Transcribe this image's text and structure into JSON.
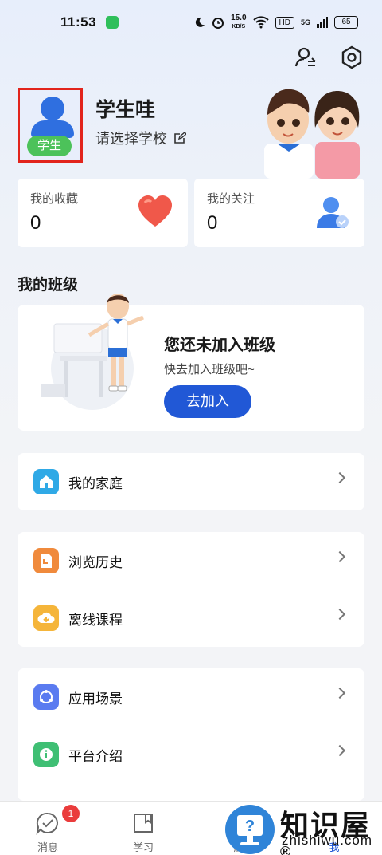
{
  "status_bar": {
    "time": "11:53",
    "speed": "15.0",
    "speed_unit": "KB/S",
    "hd": "HD",
    "net": "5G",
    "battery": "65"
  },
  "profile": {
    "name": "学生哇",
    "school_prompt": "请选择学校",
    "role_badge": "学生"
  },
  "stats": {
    "favorites_label": "我的收藏",
    "favorites_value": "0",
    "following_label": "我的关注",
    "following_value": "0"
  },
  "my_class": {
    "section_title": "我的班级",
    "empty_title": "您还未加入班级",
    "empty_subtitle": "快去加入班级吧~",
    "join_button": "去加入"
  },
  "menu": {
    "family": "我的家庭",
    "history": "浏览历史",
    "offline": "离线课程",
    "scenarios": "应用场景",
    "platform": "平台介绍"
  },
  "tabbar": {
    "messages": "消息",
    "messages_badge": "1",
    "study": "学习",
    "apply": "应",
    "me": "我"
  },
  "watermark": {
    "brand": "知识屋",
    "registered": "®",
    "domain": "zhishiwu.com"
  },
  "colors": {
    "accent": "#2158d6",
    "badge_green": "#4cc25a",
    "highlight_red": "#e2241c"
  }
}
